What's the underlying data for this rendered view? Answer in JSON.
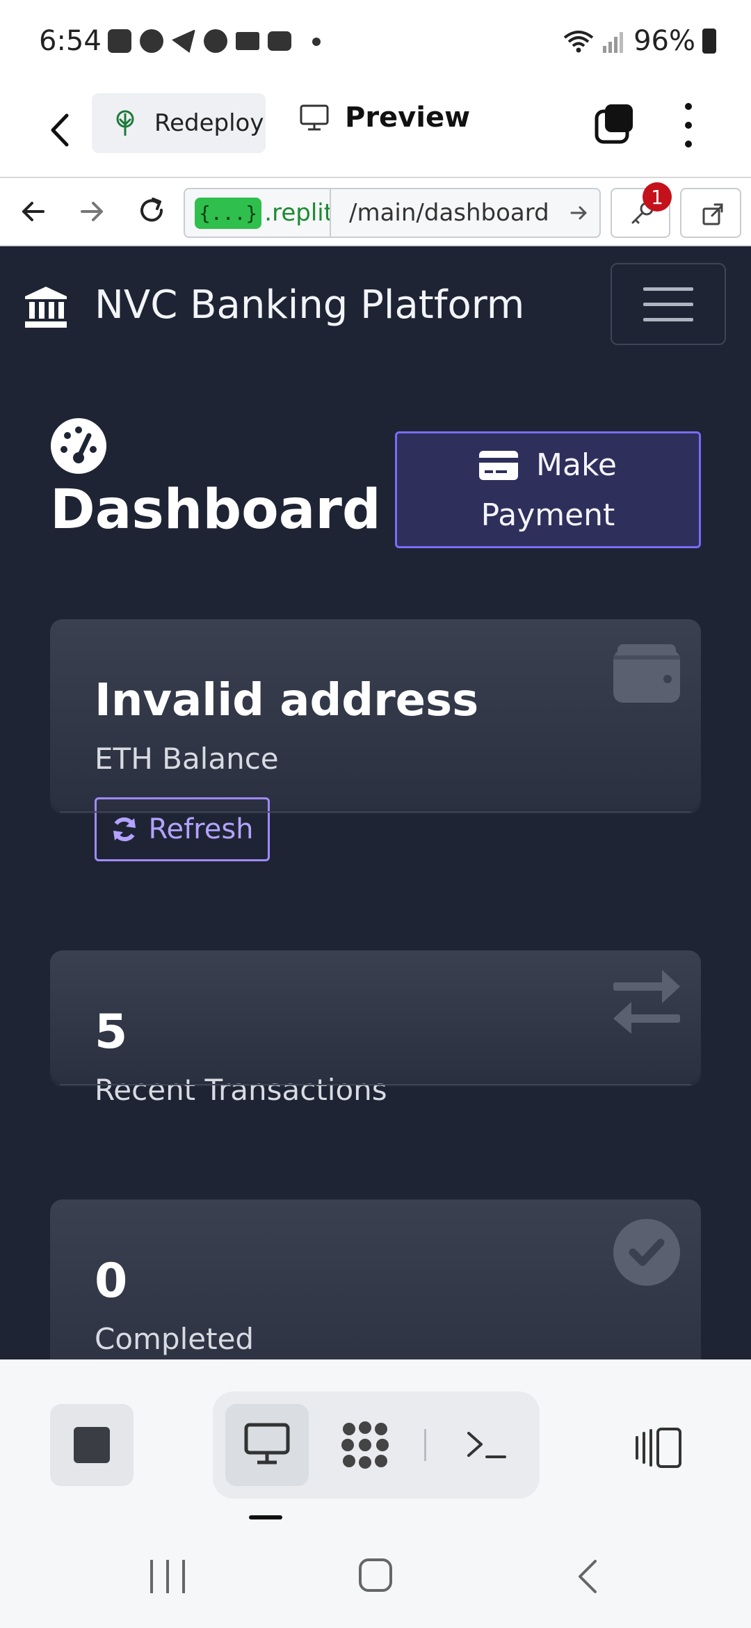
{
  "status_bar": {
    "time": "6:54",
    "battery": "96%",
    "notification_icons": [
      "replit-icon",
      "chat-icon",
      "telegram-icon",
      "viber-icon",
      "mail-icon",
      "voicemail-icon",
      "more-dot-icon"
    ]
  },
  "replit_bar": {
    "redeploy_label": "Redeploy",
    "preview_label": "Preview"
  },
  "browser": {
    "url_pill": "{...}",
    "url_domain": ".replit.c",
    "url_path": "/main/dashboard",
    "key_badge_count": "1"
  },
  "app": {
    "brand": "NVC Banking Platform",
    "page_title": "Dashboard",
    "make_payment_line1": "Make",
    "make_payment_line2": "Payment",
    "cards": [
      {
        "value": "Invalid address",
        "label": "ETH Balance",
        "button": "Refresh",
        "icon": "wallet-icon"
      },
      {
        "value": "5",
        "label": "Recent Transactions",
        "icon": "exchange-icon"
      },
      {
        "value": "0",
        "label": "Completed",
        "icon": "check-circle-icon"
      }
    ]
  },
  "colors": {
    "app_background": "#1e2434",
    "accent_purple": "#7b6cf6",
    "url_green": "#2fbf4c",
    "badge_red": "#c4111b"
  }
}
